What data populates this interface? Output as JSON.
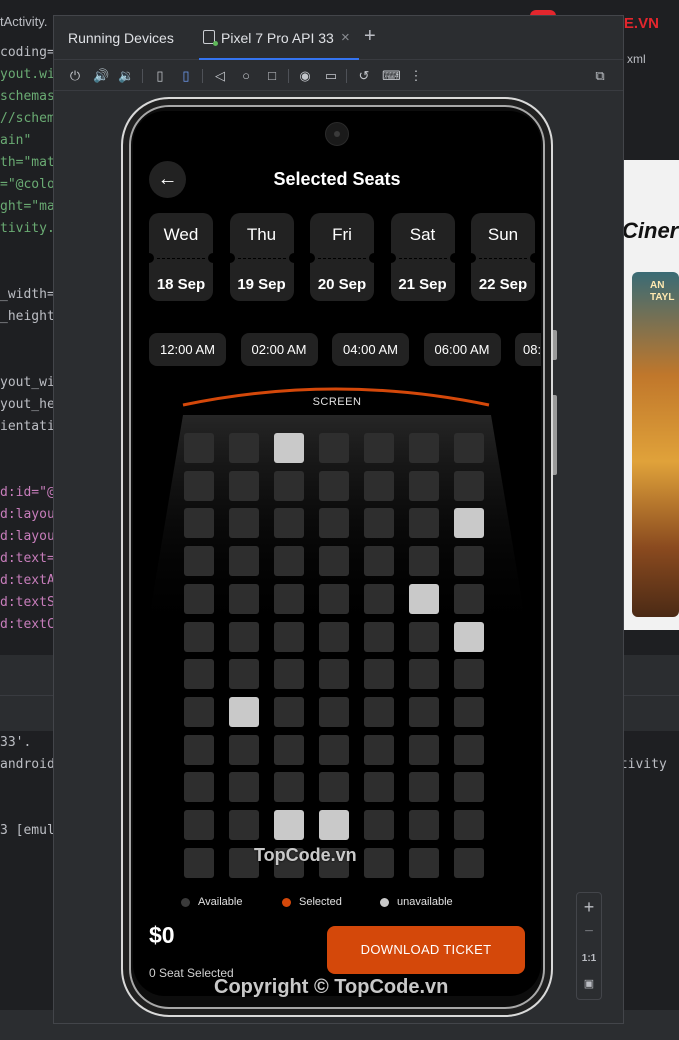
{
  "editor": {
    "top_tab": "tActivity.",
    "code_lines": [
      {
        "text": "coding=",
        "kind": "plain"
      },
      {
        "text": "yout.wi",
        "kind": "str"
      },
      {
        "text": "schemas",
        "kind": "str"
      },
      {
        "text": "//schem",
        "kind": "str"
      },
      {
        "text": "ain\"",
        "kind": "str"
      },
      {
        "text": "th=\"mat",
        "kind": "str"
      },
      {
        "text": "=\"@colo",
        "kind": "str"
      },
      {
        "text": "ght=\"ma",
        "kind": "str"
      },
      {
        "text": "tivity.",
        "kind": "str"
      },
      {
        "text": "_width=",
        "kind": "plain"
      },
      {
        "text": "_height",
        "kind": "plain"
      },
      {
        "text": "yout_wi",
        "kind": "plain"
      },
      {
        "text": "yout_he",
        "kind": "plain"
      },
      {
        "text": "ientati",
        "kind": "plain"
      },
      {
        "text": "d:id=\"@",
        "kind": "attr"
      },
      {
        "text": "d:layou",
        "kind": "attr"
      },
      {
        "text": "d:layou",
        "kind": "attr"
      },
      {
        "text": "d:text=",
        "kind": "attr"
      },
      {
        "text": "d:textA",
        "kind": "attr"
      },
      {
        "text": "d:textS",
        "kind": "attr"
      },
      {
        "text": "d:textC",
        "kind": "attr"
      },
      {
        "text": "33'.",
        "kind": "plain"
      },
      {
        "text": "android",
        "kind": "plain"
      },
      {
        "text": "3 [emul",
        "kind": "plain"
      }
    ],
    "right_tab": "xml",
    "right_title": "Ciner",
    "right_console": "ctivity",
    "poster_text": "AN\nTAYL"
  },
  "running_devices": {
    "title": "Running Devices",
    "tab_label": "Pixel 7 Pro API 33",
    "close_glyph": "×",
    "add_glyph": "+",
    "toolbar_icons": [
      "power-icon",
      "volume-up-icon",
      "volume-down-icon",
      "rotate-left-icon",
      "rotate-right-icon",
      "back-icon",
      "home-icon",
      "overview-icon",
      "screenshot-icon",
      "screen-record-icon",
      "reset-icon",
      "keyboard-icon",
      "more-icon",
      "zoom-window-icon"
    ],
    "zoom": {
      "plus": "+",
      "minus": "−",
      "one_to_one": "1:1"
    }
  },
  "app": {
    "title": "Selected Seats",
    "back_glyph": "←",
    "dates": [
      {
        "day": "Wed",
        "date": "18 Sep"
      },
      {
        "day": "Thu",
        "date": "19 Sep"
      },
      {
        "day": "Fri",
        "date": "20 Sep"
      },
      {
        "day": "Sat",
        "date": "21 Sep"
      },
      {
        "day": "Sun",
        "date": "22 Sep"
      }
    ],
    "times": [
      "12:00 AM",
      "02:00 AM",
      "04:00 AM",
      "06:00 AM",
      "08:"
    ],
    "screen_label": "SCREEN",
    "seat_rows": 12,
    "seat_cols": 7,
    "highlighted_seats": [
      [
        0,
        2
      ],
      [
        2,
        6
      ],
      [
        4,
        5
      ],
      [
        5,
        6
      ],
      [
        7,
        1
      ],
      [
        10,
        2
      ],
      [
        10,
        3
      ]
    ],
    "legend": [
      {
        "label": "Available",
        "color": "#2e2e2e"
      },
      {
        "label": "Selected",
        "color": "#d4480a"
      },
      {
        "label": "unavailable",
        "color": "#c9c9c9"
      }
    ],
    "price": "$0",
    "seat_count": "0 Seat Selected",
    "download_label": "DOWNLOAD TICKET",
    "accent": "#d4480a"
  },
  "watermarks": {
    "mid": "TopCode.vn",
    "bottom": "Copyright © TopCode.vn"
  },
  "logo": {
    "badge": "{$}",
    "text": "TOPCODE.VN"
  }
}
